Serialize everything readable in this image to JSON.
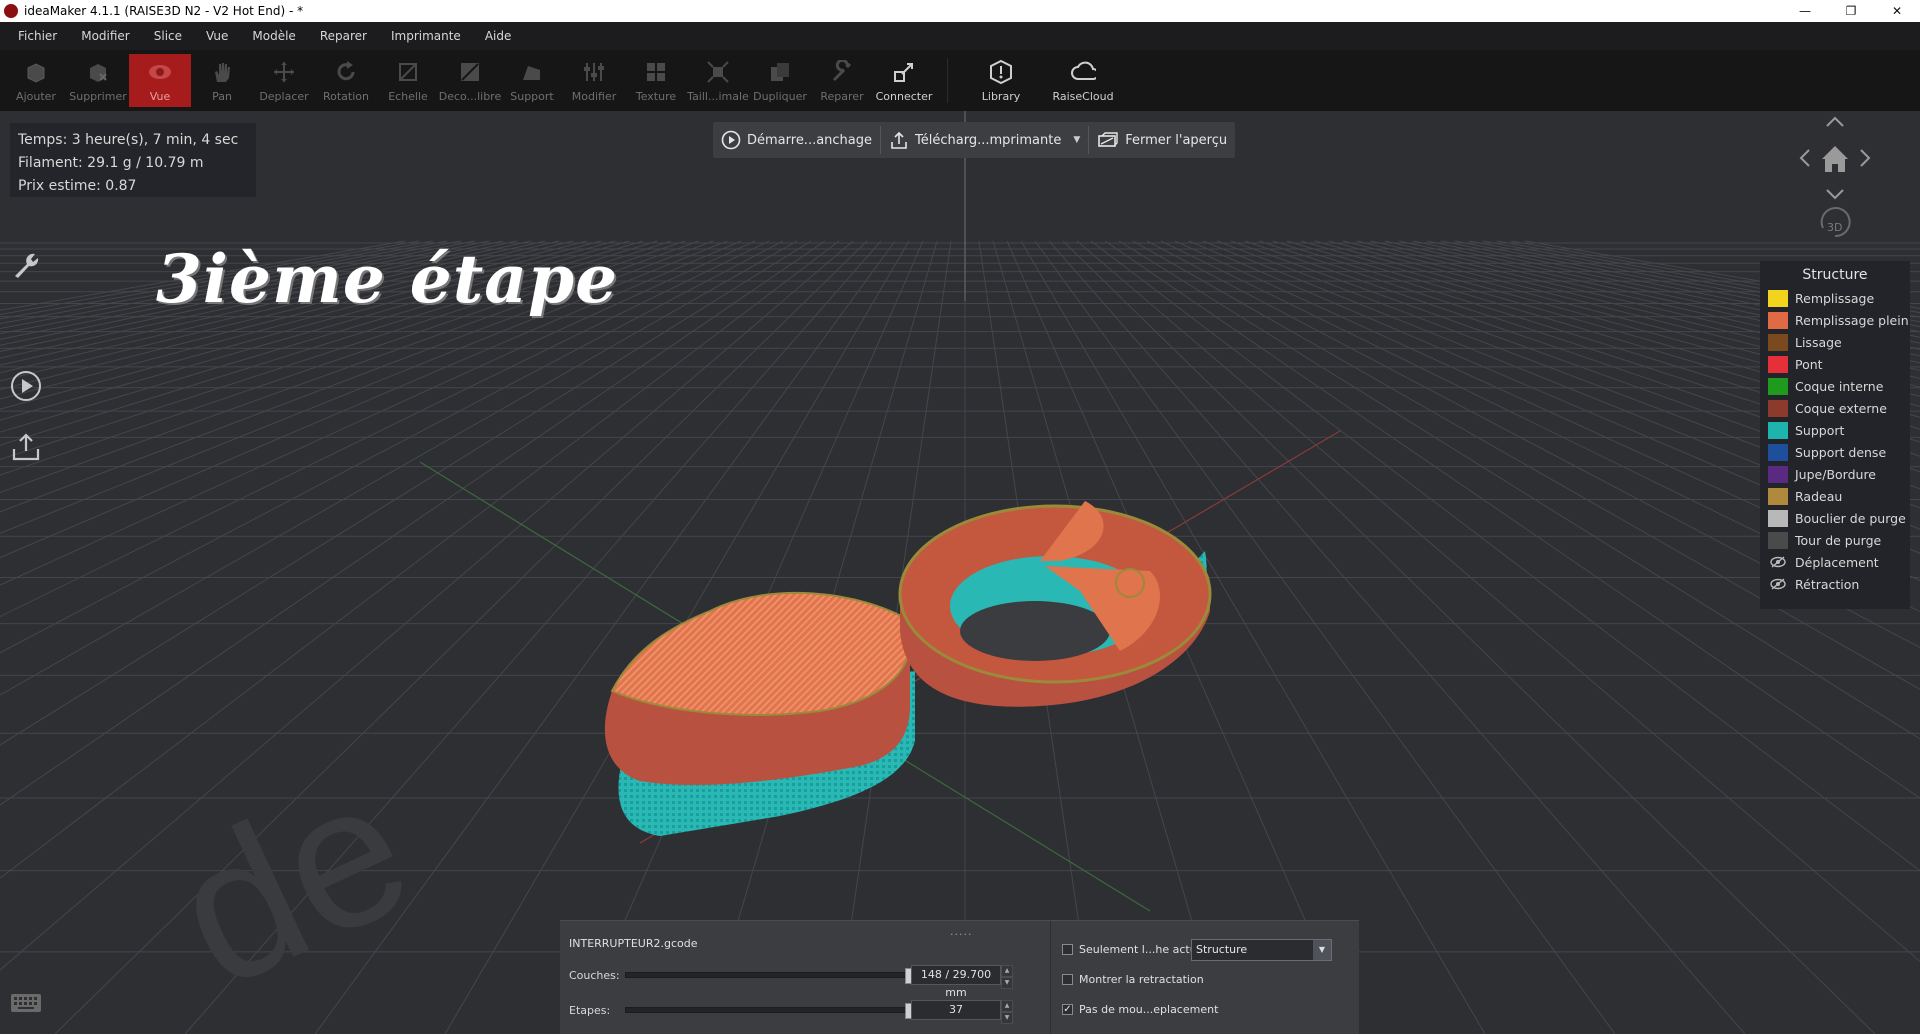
{
  "window": {
    "title": "ideaMaker 4.1.1 (RAISE3D N2 - V2 Hot End) - *",
    "controls": [
      "—",
      "❐",
      "✕"
    ]
  },
  "menu": [
    "Fichier",
    "Modifier",
    "Slice",
    "Vue",
    "Modèle",
    "Reparer",
    "Imprimante",
    "Aide"
  ],
  "toolbar": {
    "tools": [
      {
        "label": "Ajouter",
        "icon": "add-model-icon"
      },
      {
        "label": "Supprimer",
        "icon": "delete-icon"
      },
      {
        "label": "Vue",
        "icon": "eye-icon",
        "active": true
      },
      {
        "label": "Pan",
        "icon": "hand-icon"
      },
      {
        "label": "Deplacer",
        "icon": "move-icon"
      },
      {
        "label": "Rotation",
        "icon": "rotate-icon"
      },
      {
        "label": "Echelle",
        "icon": "scale-icon"
      },
      {
        "label": "Deco...libre",
        "icon": "cut-icon"
      },
      {
        "label": "Support",
        "icon": "support-icon"
      },
      {
        "label": "Modifier",
        "icon": "modifier-icon"
      },
      {
        "label": "Texture",
        "icon": "texture-icon"
      },
      {
        "label": "Taill...imale",
        "icon": "optimal-size-icon"
      },
      {
        "label": "Dupliquer",
        "icon": "duplicate-icon"
      },
      {
        "label": "Reparer",
        "icon": "repair-icon"
      },
      {
        "label": "Connecter",
        "icon": "connect-icon",
        "bright": true
      }
    ],
    "extra": [
      {
        "label": "Library",
        "icon": "library-icon"
      },
      {
        "label": "RaiseCloud",
        "icon": "cloud-icon"
      }
    ]
  },
  "info": {
    "time": "Temps: 3 heure(s), 7 min, 4 sec",
    "filament": "Filament: 29.1 g / 10.79 m",
    "price": "Prix estime: 0.87"
  },
  "caption": "3ième étape",
  "preview": {
    "start_label": "Démarre...anchage",
    "upload_label": "Télécharg...mprimante",
    "close_label": "Fermer l'aperçu"
  },
  "nav": {
    "three_d_label": "3D"
  },
  "legend": {
    "title": "Structure",
    "items": [
      {
        "label": "Remplissage",
        "color": "#f2d41f"
      },
      {
        "label": "Remplissage plein",
        "color": "#e06a44"
      },
      {
        "label": "Lissage",
        "color": "#7a4a1e"
      },
      {
        "label": "Pont",
        "color": "#e5303a"
      },
      {
        "label": "Coque interne",
        "color": "#1f9a1e"
      },
      {
        "label": "Coque externe",
        "color": "#8c3a2c"
      },
      {
        "label": "Support",
        "color": "#1fb3ad"
      },
      {
        "label": "Support dense",
        "color": "#1d4f9c"
      },
      {
        "label": "Jupe/Bordure",
        "color": "#5a2a82"
      },
      {
        "label": "Radeau",
        "color": "#b08a3c"
      },
      {
        "label": "Bouclier de purge",
        "color": "#b8b8b8"
      },
      {
        "label": "Tour de purge",
        "color": "#4a4a4a"
      }
    ],
    "hidden_items": [
      {
        "label": "Déplacement",
        "icon": "eye-hidden-icon"
      },
      {
        "label": "Rétraction",
        "icon": "eye-hidden-icon"
      }
    ]
  },
  "bottom": {
    "grip": ".....",
    "filename": "INTERRUPTEUR2.gcode",
    "layers_label": "Couches:",
    "layers_value": "148 / 29.700 mm",
    "layers_fraction": 1.0,
    "steps_label": "Etapes:",
    "steps_value": "37",
    "steps_fraction": 1.0,
    "options": [
      {
        "label": "Seulement l...he actuelle",
        "checked": false
      },
      {
        "label": "Montrer la retractation",
        "checked": false
      },
      {
        "label": "Pas de mou...eplacement",
        "checked": true
      }
    ],
    "view_select": "Structure"
  }
}
